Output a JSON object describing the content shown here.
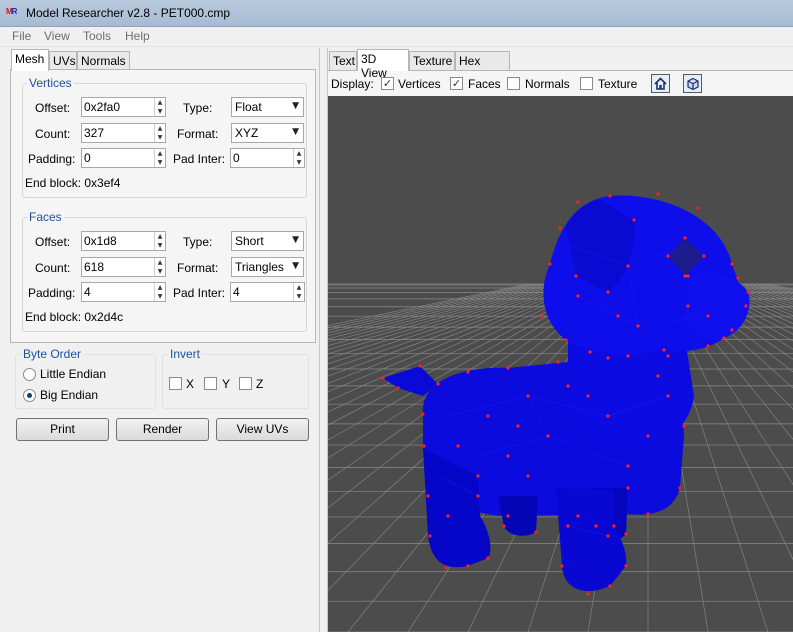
{
  "window": {
    "title": "Model Researcher v2.8 - PET000.cmp",
    "icon_text": "MR"
  },
  "menu": [
    "File",
    "View",
    "Tools",
    "Help"
  ],
  "left_tabs": [
    {
      "label": "Mesh",
      "active": true
    },
    {
      "label": "UVs",
      "active": false
    },
    {
      "label": "Normals",
      "active": false
    }
  ],
  "vertices": {
    "title": "Vertices",
    "offset_label": "Offset:",
    "offset": "0x2fa0",
    "count_label": "Count:",
    "count": "327",
    "padding_label": "Padding:",
    "padding": "0",
    "type_label": "Type:",
    "type": "Float",
    "format_label": "Format:",
    "format": "XYZ",
    "padinter_label": "Pad Inter:",
    "padinter": "0",
    "endblock": "End block: 0x3ef4"
  },
  "faces": {
    "title": "Faces",
    "offset_label": "Offset:",
    "offset": "0x1d8",
    "count_label": "Count:",
    "count": "618",
    "padding_label": "Padding:",
    "padding": "4",
    "type_label": "Type:",
    "type": "Short",
    "format_label": "Format:",
    "format": "Triangles",
    "padinter_label": "Pad Inter:",
    "padinter": "4",
    "endblock": "End block: 0x2d4c"
  },
  "byte_order": {
    "title": "Byte Order",
    "options": [
      {
        "label": "Little Endian",
        "checked": false
      },
      {
        "label": "Big Endian",
        "checked": true
      }
    ]
  },
  "invert": {
    "title": "Invert",
    "options": [
      {
        "label": "X",
        "checked": false
      },
      {
        "label": "Y",
        "checked": false
      },
      {
        "label": "Z",
        "checked": false
      }
    ]
  },
  "buttons": {
    "print": "Print",
    "render": "Render",
    "view_uvs": "View UVs"
  },
  "right_tabs": [
    {
      "label": "Text",
      "active": false
    },
    {
      "label": "3D View",
      "active": true
    },
    {
      "label": "Texture",
      "active": false
    },
    {
      "label": "Hex View",
      "active": false
    }
  ],
  "display": {
    "label": "Display:",
    "options": [
      {
        "label": "Vertices",
        "checked": true
      },
      {
        "label": "Faces",
        "checked": true
      },
      {
        "label": "Normals",
        "checked": false
      },
      {
        "label": "Texture",
        "checked": false
      }
    ],
    "icons": [
      "home-icon",
      "cube-view-icon"
    ]
  },
  "colors": {
    "mesh": "#0000e6",
    "vertex": "#ff2020",
    "background": "#4c4c4c",
    "grid": "#8a8a8a"
  }
}
